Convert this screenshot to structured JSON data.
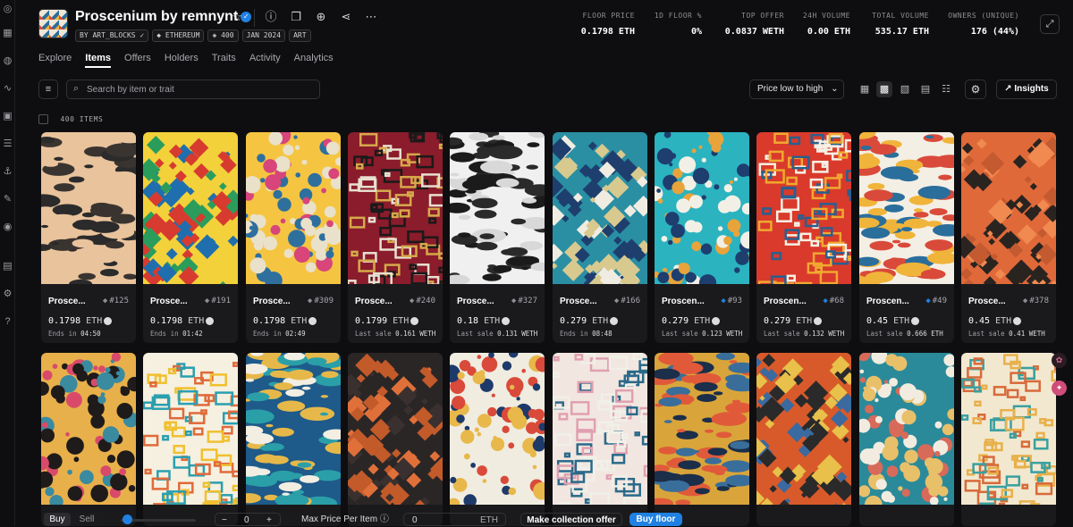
{
  "collection": {
    "title": "Proscenium by remnynt",
    "badges": [
      "BY ART_BLOCKS",
      "ETHEREUM",
      "400",
      "JAN 2024",
      "ART"
    ]
  },
  "stats": [
    {
      "label": "FLOOR PRICE",
      "value": "0.1798 ETH"
    },
    {
      "label": "1D FLOOR %",
      "value": "0%"
    },
    {
      "label": "TOP OFFER",
      "value": "0.0837 WETH"
    },
    {
      "label": "24H VOLUME",
      "value": "0.00 ETH"
    },
    {
      "label": "TOTAL VOLUME",
      "value": "535.17 ETH"
    },
    {
      "label": "OWNERS (UNIQUE)",
      "value": "176 (44%)"
    }
  ],
  "tabs": [
    "Explore",
    "Items",
    "Offers",
    "Holders",
    "Traits",
    "Activity",
    "Analytics"
  ],
  "active_tab": "Items",
  "search": {
    "placeholder": "Search by item or trait"
  },
  "sort": {
    "label": "Price low to high"
  },
  "insights_label": "Insights",
  "items_count": "400 ITEMS",
  "items": [
    {
      "name": "Prosce...",
      "number": "#125",
      "price": "0.1798",
      "unit": "ETH",
      "sub_label": "Ends in",
      "sub_value": "04:50",
      "rarity": "grey"
    },
    {
      "name": "Prosce...",
      "number": "#191",
      "price": "0.1798",
      "unit": "ETH",
      "sub_label": "Ends in",
      "sub_value": "01:42",
      "rarity": "grey"
    },
    {
      "name": "Prosce...",
      "number": "#309",
      "price": "0.1798",
      "unit": "ETH",
      "sub_label": "Ends in",
      "sub_value": "02:49",
      "rarity": "grey"
    },
    {
      "name": "Prosce...",
      "number": "#240",
      "price": "0.1799",
      "unit": "ETH",
      "sub_label": "Last sale",
      "sub_value": "0.161 WETH",
      "rarity": "grey"
    },
    {
      "name": "Prosce...",
      "number": "#327",
      "price": "0.18",
      "unit": "ETH",
      "sub_label": "Last sale",
      "sub_value": "0.131 WETH",
      "rarity": "grey"
    },
    {
      "name": "Prosce...",
      "number": "#166",
      "price": "0.279",
      "unit": "ETH",
      "sub_label": "Ends in",
      "sub_value": "08:48",
      "rarity": "grey"
    },
    {
      "name": "Proscen...",
      "number": "#93",
      "price": "0.279",
      "unit": "ETH",
      "sub_label": "Last sale",
      "sub_value": "0.123 WETH",
      "rarity": "blue"
    },
    {
      "name": "Proscen...",
      "number": "#68",
      "price": "0.279",
      "unit": "ETH",
      "sub_label": "Last sale",
      "sub_value": "0.132 WETH",
      "rarity": "blue"
    },
    {
      "name": "Proscen...",
      "number": "#49",
      "price": "0.45",
      "unit": "ETH",
      "sub_label": "Last sale",
      "sub_value": "0.666 ETH",
      "rarity": "blue"
    },
    {
      "name": "Prosce...",
      "number": "#378",
      "price": "0.45",
      "unit": "ETH",
      "sub_label": "Last sale",
      "sub_value": "0.41 WETH",
      "rarity": "grey"
    }
  ],
  "art_palettes": [
    [
      "#e9c39c",
      "#2b2b2b",
      "#e9c39c",
      "#3a3430"
    ],
    [
      "#f2d13a",
      "#1f6fae",
      "#2a9d5c",
      "#d73b2f"
    ],
    [
      "#f5c542",
      "#d7457a",
      "#2f6f9e",
      "#e9e1c9"
    ],
    [
      "#8a1c2b",
      "#1a1a1a",
      "#e8e0d0",
      "#d6a94a"
    ],
    [
      "#f0f0f0",
      "#1b1b1b",
      "#d8d8d8",
      "#2a2a2a"
    ],
    [
      "#2a8fa3",
      "#f0ece2",
      "#1e3f6e",
      "#d8c98f"
    ],
    [
      "#2bb3c0",
      "#f2f0e6",
      "#1d3e6e",
      "#e8a33b"
    ],
    [
      "#d93a2b",
      "#f5f0e4",
      "#f0a830",
      "#2a5f8f"
    ],
    [
      "#f4efe4",
      "#d94a3a",
      "#2a6e9c",
      "#f0b43a"
    ],
    [
      "#e0693a",
      "#2a2420",
      "#c45a30",
      "#f08a50"
    ],
    [
      "#e8b04a",
      "#1f1b1a",
      "#d94a6a",
      "#3a8aa0"
    ],
    [
      "#f6f0e0",
      "#f0c030",
      "#2a9fb0",
      "#e06a3a"
    ],
    [
      "#1e5a8a",
      "#f2eee2",
      "#2a9fa8",
      "#e6b84a"
    ],
    [
      "#2a2626",
      "#e0703a",
      "#3a3030",
      "#c25a2a"
    ],
    [
      "#f0ece0",
      "#1e3a6a",
      "#e8b84a",
      "#d94a3a"
    ],
    [
      "#f2e6e0",
      "#e0a0b0",
      "#2a6a8a",
      "#f0f0e8"
    ],
    [
      "#d9a53a",
      "#1b2e4a",
      "#3a6e9a",
      "#e05a3a"
    ],
    [
      "#d85a2a",
      "#3a6aa0",
      "#e8c04a",
      "#2a2a2a"
    ],
    [
      "#2a8a9a",
      "#f2ece0",
      "#e8c06a",
      "#d86a5a"
    ],
    [
      "#f2e8d0",
      "#d86a3a",
      "#3aa0a0",
      "#e8b04a"
    ],
    [
      "#1a2a4a",
      "#f0c040",
      "#e8e0c8",
      "#2a8a6a"
    ]
  ],
  "bottom": {
    "buy": "Buy",
    "sell": "Sell",
    "quantity": "0",
    "max_price_label": "Max Price Per Item",
    "max_price_value": "0",
    "unit": "ETH",
    "collection_offer": "Make collection offer",
    "buy_floor": "Buy floor"
  }
}
